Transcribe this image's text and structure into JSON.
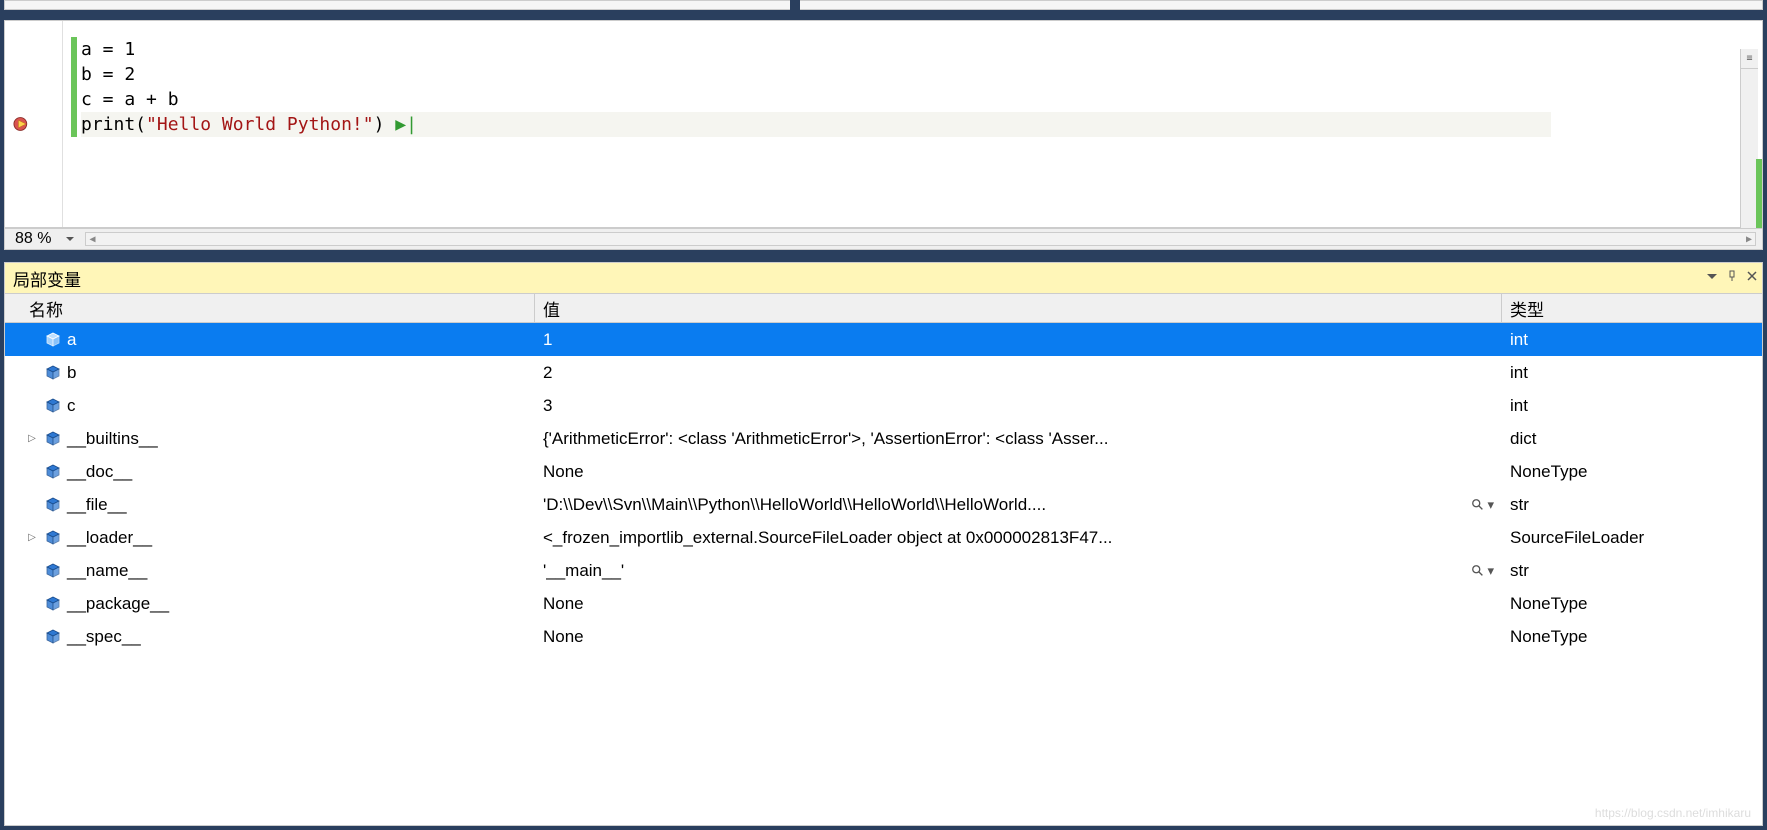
{
  "editor": {
    "lines": [
      {
        "text": "a = 1",
        "cls": ""
      },
      {
        "text": "b = 2",
        "cls": ""
      },
      {
        "text": "c = a + b",
        "cls": ""
      },
      {
        "text_prefix": "print(",
        "string": "\"Hello World Python!\"",
        "text_suffix": ")",
        "cls": "current"
      }
    ],
    "zoom_label": "88 %"
  },
  "locals": {
    "title": "局部变量",
    "headers": {
      "name": "名称",
      "value": "值",
      "type": "类型"
    },
    "rows": [
      {
        "expand": "",
        "name": "a",
        "value": "1",
        "type": "int",
        "selected": true,
        "magnify": false
      },
      {
        "expand": "",
        "name": "b",
        "value": "2",
        "type": "int",
        "selected": false,
        "magnify": false
      },
      {
        "expand": "",
        "name": "c",
        "value": "3",
        "type": "int",
        "selected": false,
        "magnify": false
      },
      {
        "expand": "▷",
        "name": "__builtins__",
        "value": "{'ArithmeticError': <class 'ArithmeticError'>, 'AssertionError': <class 'Asser...",
        "type": "dict",
        "selected": false,
        "magnify": false
      },
      {
        "expand": "",
        "name": "__doc__",
        "value": "None",
        "type": "NoneType",
        "selected": false,
        "magnify": false
      },
      {
        "expand": "",
        "name": "__file__",
        "value": "'D:\\\\Dev\\\\Svn\\\\Main\\\\Python\\\\HelloWorld\\\\HelloWorld\\\\HelloWorld....",
        "type": "str",
        "selected": false,
        "magnify": true
      },
      {
        "expand": "▷",
        "name": "__loader__",
        "value": "<_frozen_importlib_external.SourceFileLoader object at 0x000002813F47...",
        "type": "SourceFileLoader",
        "selected": false,
        "magnify": false
      },
      {
        "expand": "",
        "name": "__name__",
        "value": "'__main__'",
        "type": "str",
        "selected": false,
        "magnify": true
      },
      {
        "expand": "",
        "name": "__package__",
        "value": "None",
        "type": "NoneType",
        "selected": false,
        "magnify": false
      },
      {
        "expand": "",
        "name": "__spec__",
        "value": "None",
        "type": "NoneType",
        "selected": false,
        "magnify": false
      }
    ]
  },
  "watermark": "https://blog.csdn.net/imhikaru"
}
